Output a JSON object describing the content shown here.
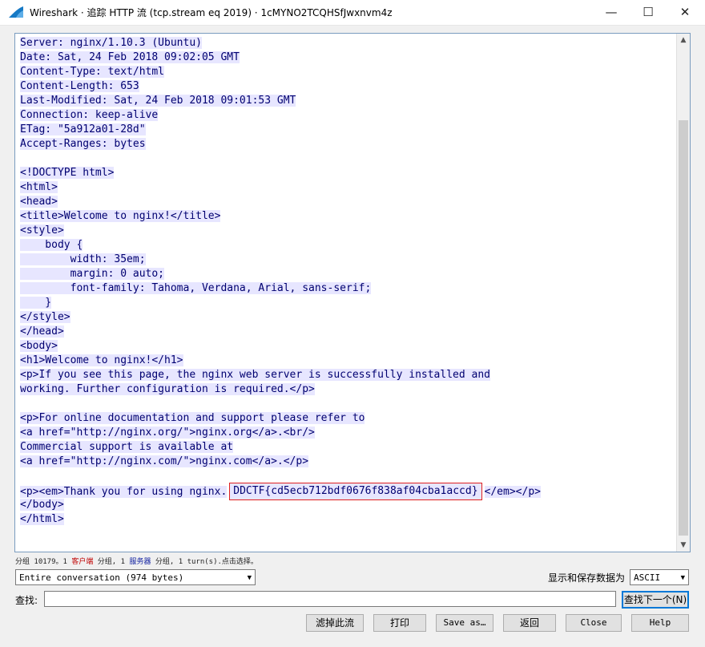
{
  "window": {
    "title": "Wireshark · 追踪 HTTP 流 (tcp.stream eq 2019) · 1cMYNO2TCQHSfJwxnvm4z",
    "controls": {
      "minimize": "—",
      "maximize": "☐",
      "close": "✕"
    }
  },
  "stream": {
    "lines": [
      "Server: nginx/1.10.3 (Ubuntu)",
      "Date: Sat, 24 Feb 2018 09:02:05 GMT",
      "Content-Type: text/html",
      "Content-Length: 653",
      "Last-Modified: Sat, 24 Feb 2018 09:01:53 GMT",
      "Connection: keep-alive",
      "ETag: \"5a912a01-28d\"",
      "Accept-Ranges: bytes",
      "",
      "<!DOCTYPE html>",
      "<html>",
      "<head>",
      "<title>Welcome to nginx!</title>",
      "<style>",
      "    body {",
      "        width: 35em;",
      "        margin: 0 auto;",
      "        font-family: Tahoma, Verdana, Arial, sans-serif;",
      "    }",
      "</style>",
      "</head>",
      "<body>",
      "<h1>Welcome to nginx!</h1>",
      "<p>If you see this page, the nginx web server is successfully installed and",
      "working. Further configuration is required.</p>",
      "",
      "<p>For online documentation and support please refer to",
      "<a href=\"http://nginx.org/\">nginx.org</a>.<br/>",
      "Commercial support is available at",
      "<a href=\"http://nginx.com/\">nginx.com</a>.</p>",
      ""
    ],
    "thank_you_prefix": "<p><em>Thank you for using nginx.",
    "flag": "DDCTF{cd5ecb712bdf0676f838af04cba1accd}",
    "thank_you_suffix": "</em></p>",
    "tail_lines": [
      "</body>",
      "</html>"
    ]
  },
  "status": {
    "part1": "分组 10179。1 ",
    "client": "客户端",
    "part2": " 分组, 1 ",
    "server": "服务器",
    "part3": " 分组, 1 turn(s).点击选择。"
  },
  "controls": {
    "conversation_select": "Entire conversation (974 bytes)",
    "format_label": "显示和保存数据为",
    "format_select": "ASCII",
    "find_label": "查找:",
    "find_value": "",
    "find_next": "查找下一个(N)",
    "filter_out": "滤掉此流",
    "print": "打印",
    "save_as": "Save as…",
    "back": "返回",
    "close": "Close",
    "help": "Help"
  },
  "colors": {
    "text": "#000070",
    "highlight": "#e7e6ff",
    "flag_border": "#e02020",
    "client": "#c00000",
    "server": "#1020a0"
  }
}
